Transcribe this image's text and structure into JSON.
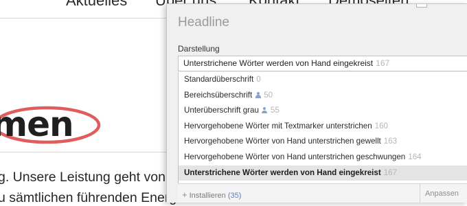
{
  "background": {
    "nav": [
      "Aktuelles",
      "Über uns",
      "Kontakt",
      "Demoseiten"
    ],
    "logo_text": "men",
    "body_lines": [
      "g. Unsere Leistung geht von",
      "u sämtlichen führenden Energiekonzernen sowie Automobilfirmen"
    ],
    "colors": {
      "logo_ellipse": "#e05d5d",
      "logo_text": "#1f1f1f"
    }
  },
  "dialog": {
    "title": "Headline",
    "field_label": "Darstellung",
    "selected": {
      "label": "Unterstrichene Wörter werden von Hand eingekreist",
      "count": "167"
    },
    "options": [
      {
        "label": "Standardüberschrift",
        "count": "0",
        "icon": "",
        "selected": false
      },
      {
        "label": "Bereichsüberschrift",
        "count": "50",
        "icon": "user-icon",
        "selected": false
      },
      {
        "label": "Unterüberschrift grau",
        "count": "55",
        "icon": "user-icon",
        "selected": false
      },
      {
        "label": "Hervorgehobene Wörter mit Textmarker unterstrichen",
        "count": "160",
        "icon": "",
        "selected": false
      },
      {
        "label": "Hervorgehobene Wörter von Hand unterstrichen gewellt",
        "count": "163",
        "icon": "",
        "selected": false
      },
      {
        "label": "Hervorgehobene Wörter von Hand unterstrichen geschwungen",
        "count": "164",
        "icon": "",
        "selected": false
      },
      {
        "label": "Unterstrichene Wörter werden von Hand eingekreist",
        "count": "167",
        "icon": "",
        "selected": true
      }
    ],
    "footer": {
      "install_label": "Installieren",
      "install_count": "(35)",
      "adjust_label": "Anpassen"
    }
  }
}
